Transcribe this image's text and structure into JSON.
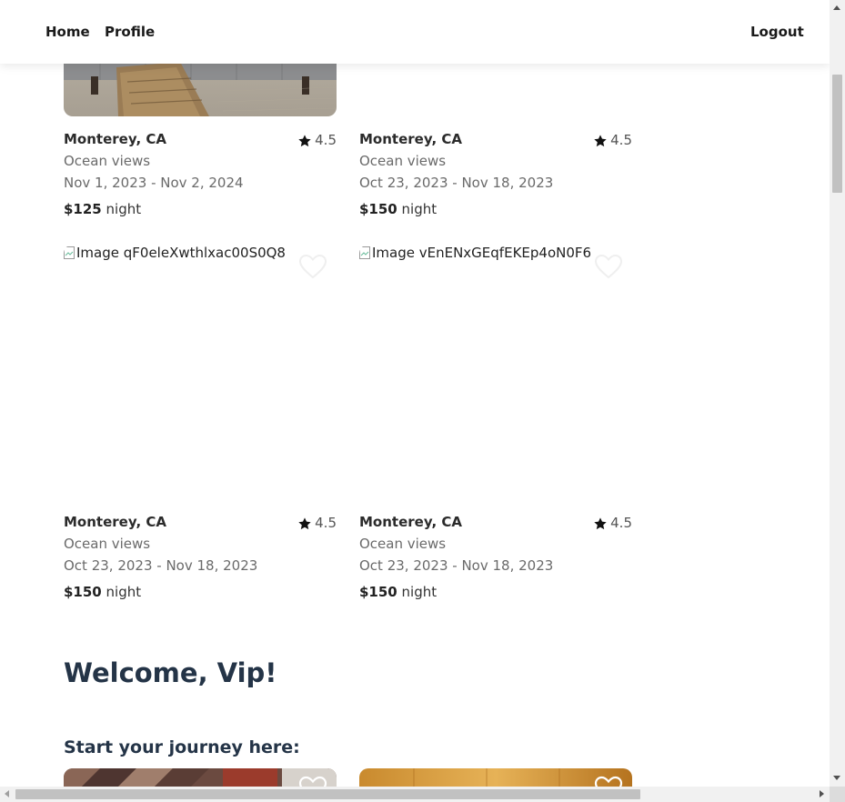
{
  "nav": {
    "home": "Home",
    "profile": "Profile",
    "logout": "Logout"
  },
  "listings": [
    {
      "location": "Monterey, CA",
      "rating": "4.5",
      "feature": "Ocean views",
      "dates": "Nov 1, 2023 - Nov 2, 2024",
      "price": "$125",
      "unit": "night",
      "image_alt": ""
    },
    {
      "location": "Monterey, CA",
      "rating": "4.5",
      "feature": "Ocean views",
      "dates": "Oct 23, 2023 - Nov 18, 2023",
      "price": "$150",
      "unit": "night",
      "image_alt": ""
    },
    {
      "location": "Monterey, CA",
      "rating": "4.5",
      "feature": "Ocean views",
      "dates": "Oct 23, 2023 - Nov 18, 2023",
      "price": "$150",
      "unit": "night",
      "image_alt": "Image qF0eleXwthlxac00S0Q8"
    },
    {
      "location": "Monterey, CA",
      "rating": "4.5",
      "feature": "Ocean views",
      "dates": "Oct 23, 2023 - Nov 18, 2023",
      "price": "$150",
      "unit": "night",
      "image_alt": "Image vEnENxGEqfEKEp4oN0F6"
    }
  ],
  "welcome": "Welcome, Vip!",
  "journey": "Start your journey here:",
  "icons": {
    "favorite": "heart-icon",
    "rating": "star-icon"
  }
}
